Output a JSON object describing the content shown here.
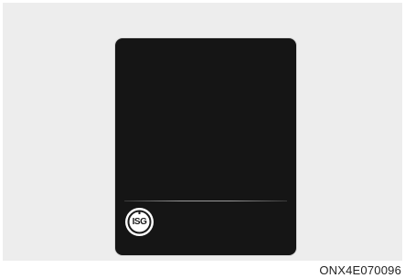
{
  "display": {
    "icon": {
      "name": "auto-hold-icon",
      "text": "ISG"
    }
  },
  "figure_code": "ONX4E070096"
}
